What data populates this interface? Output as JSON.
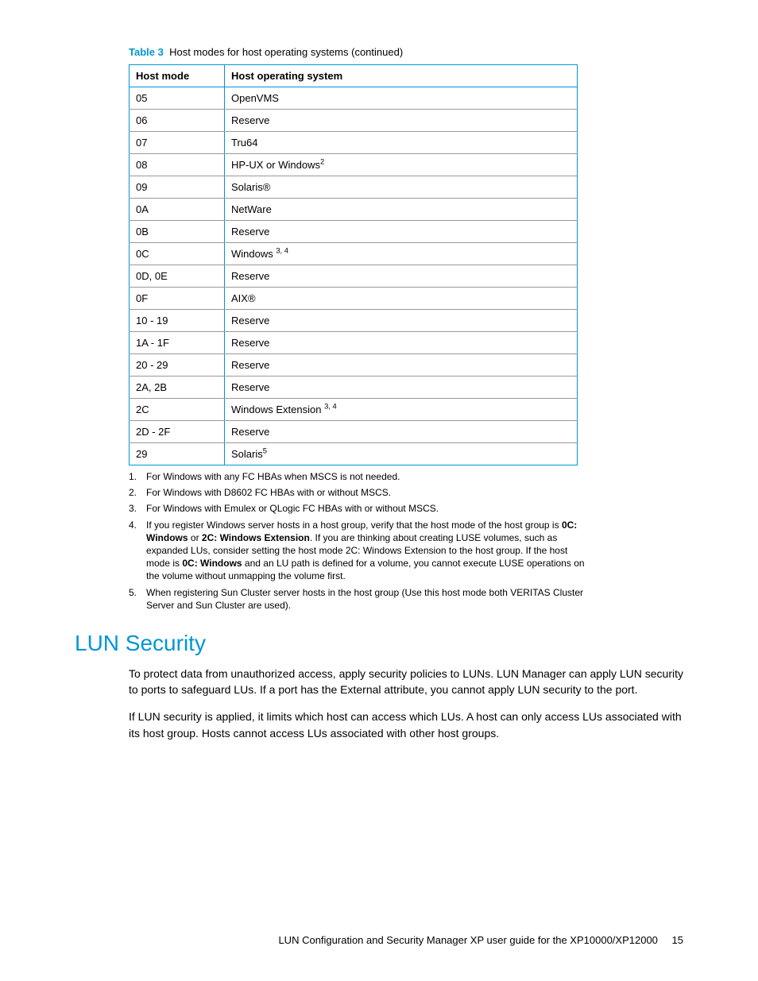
{
  "table": {
    "label": "Table 3",
    "caption": "Host modes for host operating systems (continued)",
    "headers": {
      "col1": "Host mode",
      "col2": "Host operating system"
    },
    "rows": [
      {
        "mode": "05",
        "os": "OpenVMS",
        "sup": ""
      },
      {
        "mode": "06",
        "os": "Reserve",
        "sup": ""
      },
      {
        "mode": "07",
        "os": "Tru64",
        "sup": ""
      },
      {
        "mode": "08",
        "os": "HP-UX or Windows",
        "sup": "2"
      },
      {
        "mode": "09",
        "os": "Solaris®",
        "sup": ""
      },
      {
        "mode": "0A",
        "os": "NetWare",
        "sup": ""
      },
      {
        "mode": "0B",
        "os": "Reserve",
        "sup": ""
      },
      {
        "mode": "0C",
        "os": "Windows ",
        "sup": "3, 4"
      },
      {
        "mode": "0D, 0E",
        "os": "Reserve",
        "sup": ""
      },
      {
        "mode": "0F",
        "os": "AIX®",
        "sup": ""
      },
      {
        "mode": "10 - 19",
        "os": "Reserve",
        "sup": ""
      },
      {
        "mode": "1A - 1F",
        "os": "Reserve",
        "sup": ""
      },
      {
        "mode": "20 - 29",
        "os": "Reserve",
        "sup": ""
      },
      {
        "mode": "2A, 2B",
        "os": "Reserve",
        "sup": ""
      },
      {
        "mode": "2C",
        "os": "Windows Extension ",
        "sup": "3, 4"
      },
      {
        "mode": "2D - 2F",
        "os": "Reserve",
        "sup": ""
      },
      {
        "mode": "29",
        "os": "Solaris",
        "sup": "5"
      }
    ]
  },
  "footnotes": [
    {
      "num": "1.",
      "text": "For Windows with any FC HBAs when MSCS is not needed."
    },
    {
      "num": "2.",
      "text": "For Windows with D8602 FC HBAs with or without MSCS."
    },
    {
      "num": "3.",
      "text": "For Windows with Emulex or QLogic FC HBAs with or without MSCS."
    },
    {
      "num": "4.",
      "text_pre": "If you register Windows server hosts in a host group, verify that the host mode of the host group is ",
      "bold1": "0C: Windows",
      "text_mid": " or ",
      "bold2": "2C: Windows Extension",
      "text_mid2": ". If you are thinking about creating LUSE volumes, such as expanded LUs, consider setting the host mode 2C: Windows Extension to the host group. If the host mode is ",
      "bold3": "0C: Windows",
      "text_post": " and an LU path is defined for a volume, you cannot execute LUSE operations on the volume without unmapping the volume first."
    },
    {
      "num": "5.",
      "text": "When registering Sun Cluster server hosts in the host group (Use this host mode both VERITAS Cluster Server and Sun Cluster are used)."
    }
  ],
  "section": {
    "title": "LUN Security",
    "p1": "To protect data from unauthorized access, apply security policies to LUNs. LUN Manager can apply LUN security to ports to safeguard LUs. If a port has the External attribute, you cannot apply LUN security to the port.",
    "p2": "If LUN security is applied, it limits which host can access which LUs. A host can only access LUs associated with its host group. Hosts cannot access LUs associated with other host groups."
  },
  "footer": {
    "text": "LUN Configuration and Security Manager XP user guide for the XP10000/XP12000",
    "page": "15"
  }
}
